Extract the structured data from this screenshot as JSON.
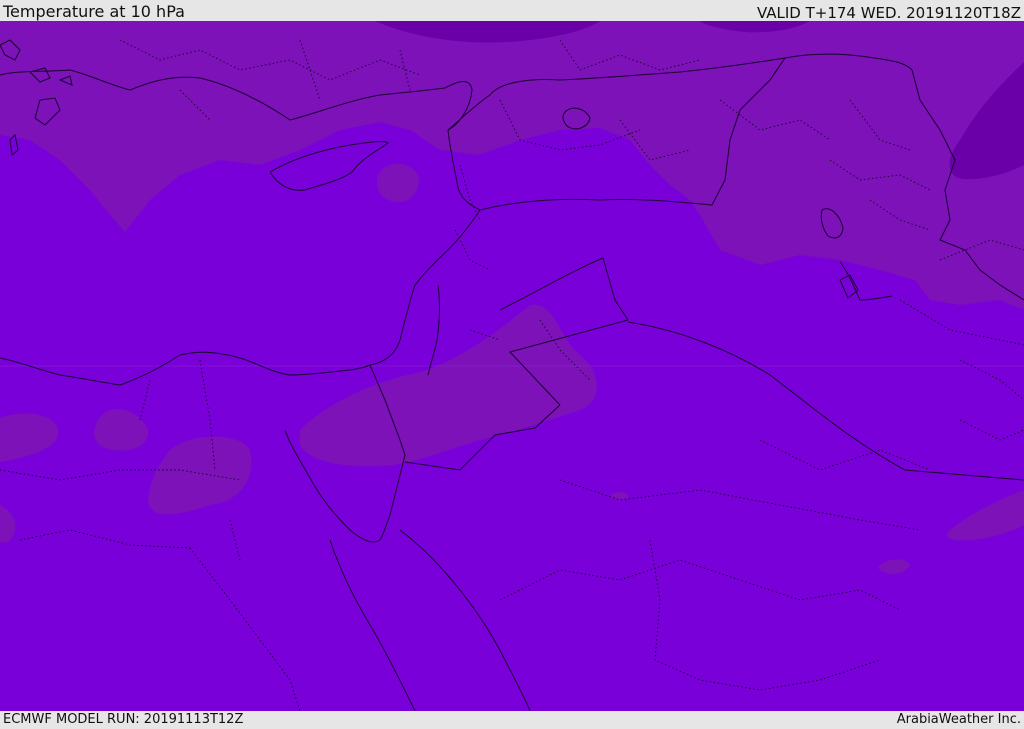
{
  "header": {
    "title": "Temperature at 10 hPa",
    "valid": "VALID T+174 WED. 20191120T18Z"
  },
  "footer": {
    "model_run": "ECMWF MODEL RUN: 20191113T12Z",
    "provider": "ArabiaWeather Inc."
  },
  "colors": {
    "base_field": "#7a00d9",
    "warmer_band": "#7c12b8",
    "darker_band": "#6a00a8",
    "darkest_core": "#5c0099",
    "bar_background": "#e6e6e6"
  },
  "icons": {
    "map": "weather-field-map"
  }
}
